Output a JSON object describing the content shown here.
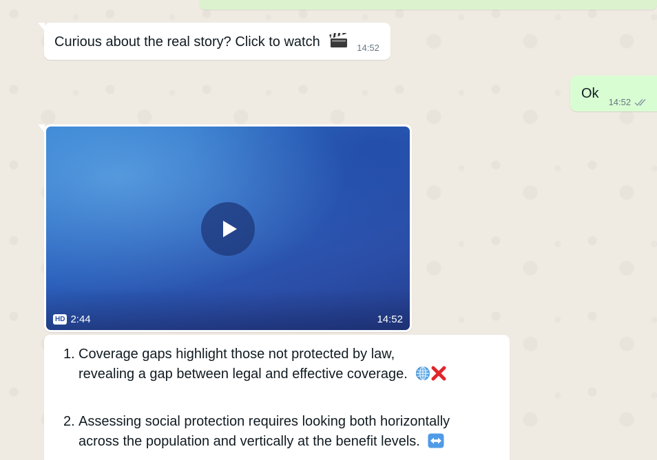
{
  "messages": {
    "incoming_text": {
      "text": "Curious about the real story? Click to watch",
      "emoji": "clapper-board-icon",
      "time": "14:52"
    },
    "outgoing_text": {
      "text": "Ok",
      "time": "14:52",
      "status": "read"
    },
    "video": {
      "quality_badge": "HD",
      "duration": "2:44",
      "time": "14:52"
    },
    "list": {
      "items": [
        {
          "number": "1.",
          "line1": "Coverage gaps highlight those not protected by law,",
          "line2": "revealing a gap between legal and effective coverage.",
          "emojis": [
            "globe-icon",
            "cross-mark-icon"
          ]
        },
        {
          "number": "2.",
          "line1": "Assessing social protection requires looking both horizontally",
          "line2": "across the population and vertically at the benefit levels.",
          "emojis": [
            "left-right-arrow-icon"
          ]
        }
      ]
    }
  },
  "colors": {
    "chat_background": "#efeae2",
    "incoming_bubble": "#ffffff",
    "outgoing_bubble": "#d9fdd3",
    "timestamp": "#667781",
    "read_ticks": "#8696a0"
  }
}
